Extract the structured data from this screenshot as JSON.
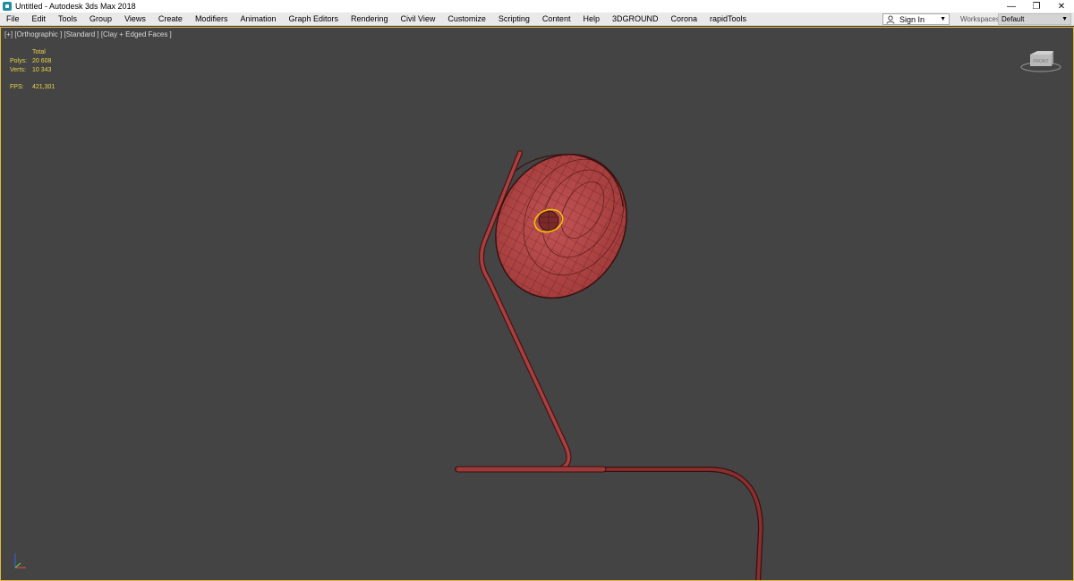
{
  "window": {
    "title": "Untitled - Autodesk 3ds Max 2018",
    "controls": {
      "minimize": "—",
      "restore": "❐",
      "close": "✕"
    }
  },
  "menubar": {
    "items": [
      "File",
      "Edit",
      "Tools",
      "Group",
      "Views",
      "Create",
      "Modifiers",
      "Animation",
      "Graph Editors",
      "Rendering",
      "Civil View",
      "Customize",
      "Scripting",
      "Content",
      "Help",
      "3DGROUND",
      "Corona",
      "rapidTools"
    ],
    "signin_label": "Sign In",
    "workspaces_label": "Workspaces:",
    "workspaces_value": "Default"
  },
  "viewport": {
    "label": "[+] [Orthographic ] [Standard ] [Clay + Edged Faces ]",
    "stats": {
      "header": "Total",
      "polys_label": "Polys:",
      "polys_value": "20 608",
      "verts_label": "Verts:",
      "verts_value": "10 343",
      "fps_label": "FPS:",
      "fps_value": "421,301"
    }
  },
  "colors": {
    "viewport_bg": "#444444",
    "accent_border": "#e0b73a",
    "stats_text": "#e8d44a",
    "model_red": "#b84848",
    "wire": "#5a1a1a"
  },
  "icons": [
    "app-icon",
    "user-icon",
    "chevron-down-icon",
    "viewcube-icon",
    "axis-gizmo-icon"
  ]
}
